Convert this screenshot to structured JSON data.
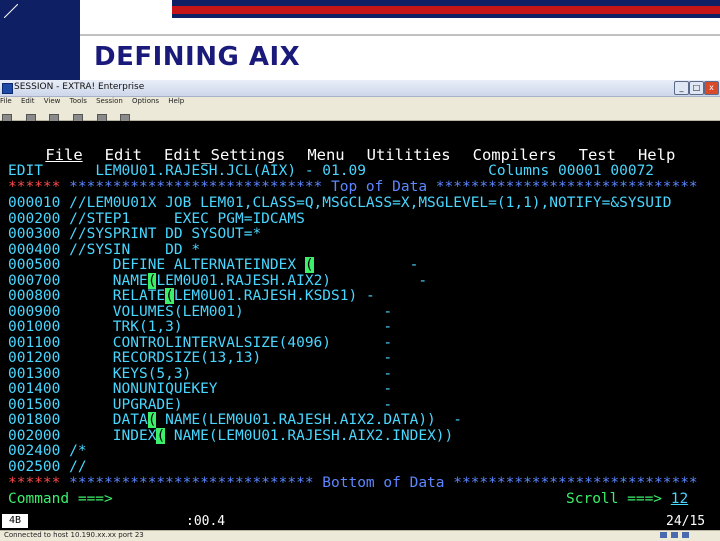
{
  "slide": {
    "title": "DEFINING AIX"
  },
  "window": {
    "title": "SESSION - EXTRA! Enterprise",
    "menu": [
      "File",
      "Edit",
      "View",
      "Tools",
      "Session",
      "Options",
      "Help"
    ],
    "buttons": {
      "minimize": "_",
      "maximize": "□",
      "close": "x"
    }
  },
  "ispf": {
    "menu": [
      "File",
      "Edit",
      "Edit_Settings",
      "Menu",
      "Utilities",
      "Compilers",
      "Test",
      "Help"
    ],
    "header": {
      "mode": "EDIT",
      "dataset": "LEM0U01.RAJESH.JCL(AIX) - 01.09",
      "columns_label": "Columns",
      "columns_value": "00001 00072"
    },
    "top_marker": {
      "stars": "******",
      "text": "***************************** Top of Data ******************************"
    },
    "lines": [
      {
        "num": "000010",
        "text": "//LEM0U01X JOB LEM01,CLASS=Q,MSGCLASS=X,MSGLEVEL=(1,1),NOTIFY=&SYSUID"
      },
      {
        "num": "000200",
        "text": "//STEP1     EXEC PGM=IDCAMS"
      },
      {
        "num": "000300",
        "text": "//SYSPRINT DD SYSOUT=*"
      },
      {
        "num": "000400",
        "text": "//SYSIN    DD *"
      },
      {
        "num": "000500",
        "pre": "     DEFINE ALTERNATEINDEX ",
        "hl": "(",
        "post": "           -"
      },
      {
        "num": "000700",
        "pre": "     NAME",
        "hl": "(",
        "post": "LEM0U01.RAJESH.AIX2)          -"
      },
      {
        "num": "000800",
        "pre": "     RELATE",
        "hl": "(",
        "post": "LEM0U01.RAJESH.KSDS1) -"
      },
      {
        "num": "000900",
        "text": "     VOLUMES(LEM001)                -"
      },
      {
        "num": "001000",
        "text": "     TRK(1,3)                       -"
      },
      {
        "num": "001100",
        "text": "     CONTROLINTERVALSIZE(4096)      -"
      },
      {
        "num": "001200",
        "text": "     RECORDSIZE(13,13)              -"
      },
      {
        "num": "001300",
        "text": "     KEYS(5,3)                      -"
      },
      {
        "num": "001400",
        "text": "     NONUNIQUEKEY                   -"
      },
      {
        "num": "001500",
        "text": "     UPGRADE)                       -"
      },
      {
        "num": "001800",
        "pre": "     DATA",
        "hl": "(",
        "post": " NAME(LEM0U01.RAJESH.AIX2.DATA))  -"
      },
      {
        "num": "002000",
        "pre": "     INDEX",
        "hl": "(",
        "post": " NAME(LEM0U01.RAJESH.AIX2.INDEX))"
      },
      {
        "num": "002400",
        "text": "/*"
      },
      {
        "num": "002500",
        "text": "//"
      }
    ],
    "bottom_marker": {
      "stars": "******",
      "text": "**************************** Bottom of Data ****************************"
    },
    "command": {
      "label": "Command ===>",
      "value": ""
    },
    "scroll": {
      "label": "Scroll ===>",
      "value": "12"
    }
  },
  "status": {
    "mode": "4B",
    "time": ":00.4",
    "position": "24/15"
  },
  "statusbar": {
    "text": "Connected to host 10.190.xx.xx port 23"
  },
  "colors": {
    "navy": "#0f1f63",
    "red": "#c41616",
    "terminal_bg": "#000000",
    "cyan": "#49d6ff",
    "green": "#3cf06a"
  }
}
